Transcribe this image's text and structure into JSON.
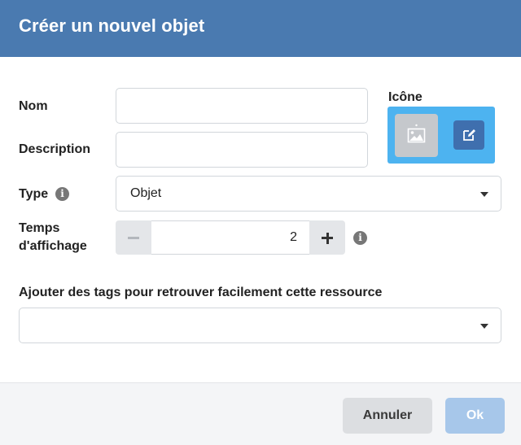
{
  "dialog": {
    "title": "Créer un nouvel objet"
  },
  "form": {
    "name_label": "Nom",
    "name_value": "",
    "description_label": "Description",
    "description_value": "",
    "icon_label": "Icône",
    "type_label": "Type",
    "type_value": "Objet",
    "display_time_label_line1": "Temps",
    "display_time_label_line2": "d'affichage",
    "display_time_value": "2",
    "tags_label": "Ajouter des tags pour retrouver facilement cette ressource",
    "tags_value": ""
  },
  "icons": {
    "info": "info-icon",
    "image_placeholder": "image-placeholder-icon",
    "edit": "edit-icon",
    "dropdown": "chevron-down-icon",
    "minus": "minus-icon",
    "plus": "plus-icon"
  },
  "footer": {
    "cancel_label": "Annuler",
    "ok_label": "Ok"
  },
  "colors": {
    "header": "#4a7ab0",
    "icon_panel": "#4db3f0",
    "edit_button": "#3f6fae",
    "ok_button_disabled": "#a7c7ea"
  }
}
